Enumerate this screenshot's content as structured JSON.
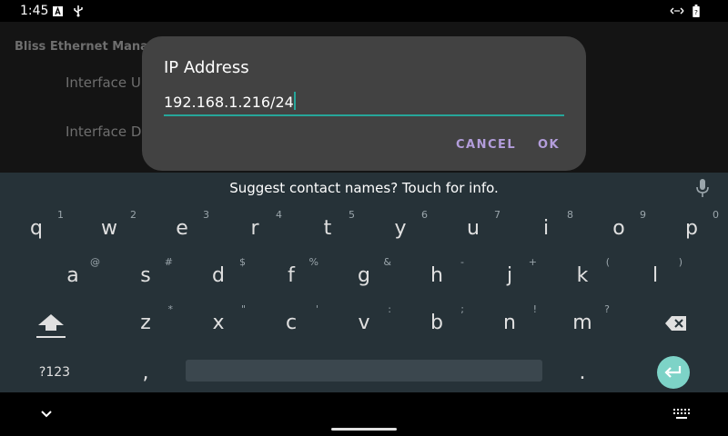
{
  "status": {
    "time": "1:45"
  },
  "app": {
    "title": "Bliss Ethernet Manager",
    "items": [
      "Interface Up",
      "Interface Down"
    ]
  },
  "dialog": {
    "title": "IP Address",
    "value": "192.168.1.216/24",
    "cancel": "CANCEL",
    "ok": "OK"
  },
  "keyboard": {
    "suggestion": "Suggest contact names? Touch for info.",
    "row1": [
      {
        "k": "q",
        "h": "1"
      },
      {
        "k": "w",
        "h": "2"
      },
      {
        "k": "e",
        "h": "3"
      },
      {
        "k": "r",
        "h": "4"
      },
      {
        "k": "t",
        "h": "5"
      },
      {
        "k": "y",
        "h": "6"
      },
      {
        "k": "u",
        "h": "7"
      },
      {
        "k": "i",
        "h": "8"
      },
      {
        "k": "o",
        "h": "9"
      },
      {
        "k": "p",
        "h": "0"
      }
    ],
    "row2": [
      {
        "k": "a",
        "h": "@"
      },
      {
        "k": "s",
        "h": "#"
      },
      {
        "k": "d",
        "h": "$"
      },
      {
        "k": "f",
        "h": "%"
      },
      {
        "k": "g",
        "h": "&"
      },
      {
        "k": "h",
        "h": "-"
      },
      {
        "k": "j",
        "h": "+"
      },
      {
        "k": "k",
        "h": "("
      },
      {
        "k": "l",
        "h": ")"
      }
    ],
    "row3": [
      {
        "k": "z",
        "h": "*"
      },
      {
        "k": "x",
        "h": "\""
      },
      {
        "k": "c",
        "h": "'"
      },
      {
        "k": "v",
        "h": ":"
      },
      {
        "k": "b",
        "h": ";"
      },
      {
        "k": "n",
        "h": "!"
      },
      {
        "k": "m",
        "h": "?"
      }
    ],
    "symbols_label": "?123",
    "comma": ",",
    "period": "."
  },
  "colors": {
    "accent": "#26a69a",
    "dialog_button": "#b39ddb",
    "keyboard_bg": "#263238"
  }
}
